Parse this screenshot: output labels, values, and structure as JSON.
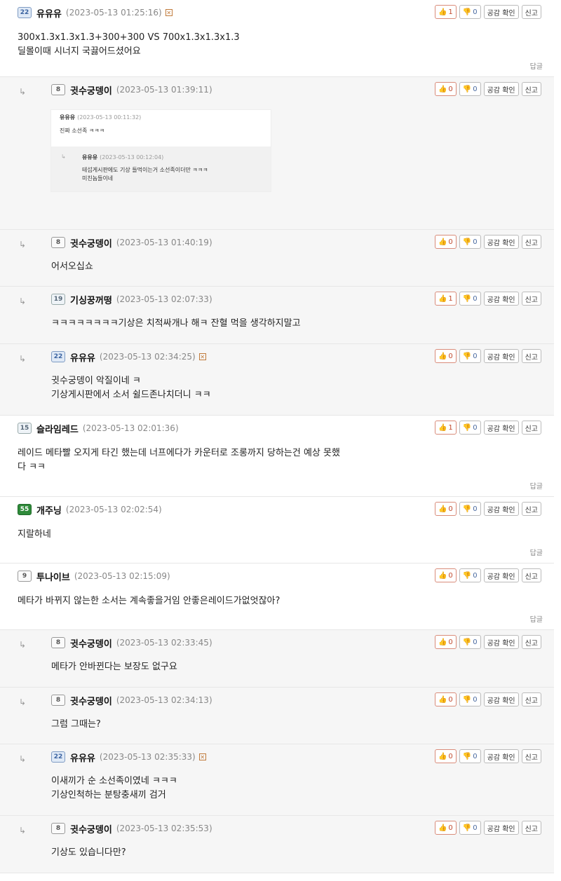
{
  "buttons": {
    "empathy_check": "공감 확인",
    "report": "신고",
    "reply": "답글"
  },
  "quoted": {
    "nick_a": "유유유",
    "date_a": "(2023-05-13 00:11:32)",
    "text_a": "진짜 소선족 ㅋㅋㅋ",
    "nick_b": "유유유",
    "date_b": "(2023-05-13 00:12:04)",
    "text_b": "테섭게시판에도 기상 들먹이는거 소선족이더만 ㅋㅋㅋ\n미친놈들이네"
  },
  "comments": [
    {
      "type": "top",
      "level": "22",
      "nick": "유유유",
      "date": "(2023-05-13 01:25:16)",
      "mark": true,
      "up": "1",
      "down": "0",
      "text": "300x1.3x1.3x1.3+300+300 VS 700x1.3x1.3x1.3\n딜몰이때 시너지 국끓어드셨어요",
      "reply": true
    },
    {
      "type": "reply",
      "level": "8",
      "nick": "귓수궁뎅이",
      "date": "(2023-05-13 01:39:11)",
      "up": "0",
      "down": "0",
      "text": "",
      "quote": true
    },
    {
      "type": "reply",
      "level": "8",
      "nick": "귓수궁뎅이",
      "date": "(2023-05-13 01:40:19)",
      "up": "0",
      "down": "0",
      "text": "어서오십쇼"
    },
    {
      "type": "reply",
      "level": "19",
      "nick": "기싱꿍꺼떵",
      "date": "(2023-05-13 02:07:33)",
      "up": "1",
      "down": "0",
      "text": "ㅋㅋㅋㅋㅋㅋㅋㅋ기상은 치적싸개나 해ㅋ 잔혈 먹을 생각하지말고"
    },
    {
      "type": "reply",
      "level": "22",
      "nick": "유유유",
      "date": "(2023-05-13 02:34:25)",
      "mark": true,
      "up": "0",
      "down": "0",
      "text": "귓수궁뎅이 악질이네 ㅋ\n기상게시판에서 소서 쉴드존나치더니 ㅋㅋ"
    },
    {
      "type": "top",
      "level": "15",
      "nick": "슬라임레드",
      "date": "(2023-05-13 02:01:36)",
      "up": "1",
      "down": "0",
      "text": "레이드 메타빨 오지게 타긴 했는데 너프에다가 카운터로 조롱까지 당하는건 예상 못했\n다 ㅋㅋ",
      "reply": true
    },
    {
      "type": "top",
      "level": "55",
      "nick": "개주닝",
      "date": "(2023-05-13 02:02:54)",
      "up": "0",
      "down": "0",
      "text": "지랄하네",
      "reply": true
    },
    {
      "type": "top",
      "level": "9",
      "nick": "투나이브",
      "date": "(2023-05-13 02:15:09)",
      "up": "0",
      "down": "0",
      "text": "메타가 바뀌지 않는한 소서는 계속좋을거임 안좋은레이드가없엇잖아?",
      "reply": true
    },
    {
      "type": "reply",
      "level": "8",
      "nick": "귓수궁뎅이",
      "date": "(2023-05-13 02:33:45)",
      "up": "0",
      "down": "0",
      "text": "메타가 안바뀐다는 보장도 없구요"
    },
    {
      "type": "reply",
      "level": "8",
      "nick": "귓수궁뎅이",
      "date": "(2023-05-13 02:34:13)",
      "up": "0",
      "down": "0",
      "text": "그럼 그때는?"
    },
    {
      "type": "reply",
      "level": "22",
      "nick": "유유유",
      "date": "(2023-05-13 02:35:33)",
      "mark": true,
      "up": "0",
      "down": "0",
      "text": "이새끼가 순 소선족이였네 ㅋㅋㅋ\n기상인척하는 분탕충새끼 검거"
    },
    {
      "type": "reply",
      "level": "8",
      "nick": "귓수궁뎅이",
      "date": "(2023-05-13 02:35:53)",
      "up": "0",
      "down": "0",
      "text": "기상도 있습니다만?"
    }
  ]
}
